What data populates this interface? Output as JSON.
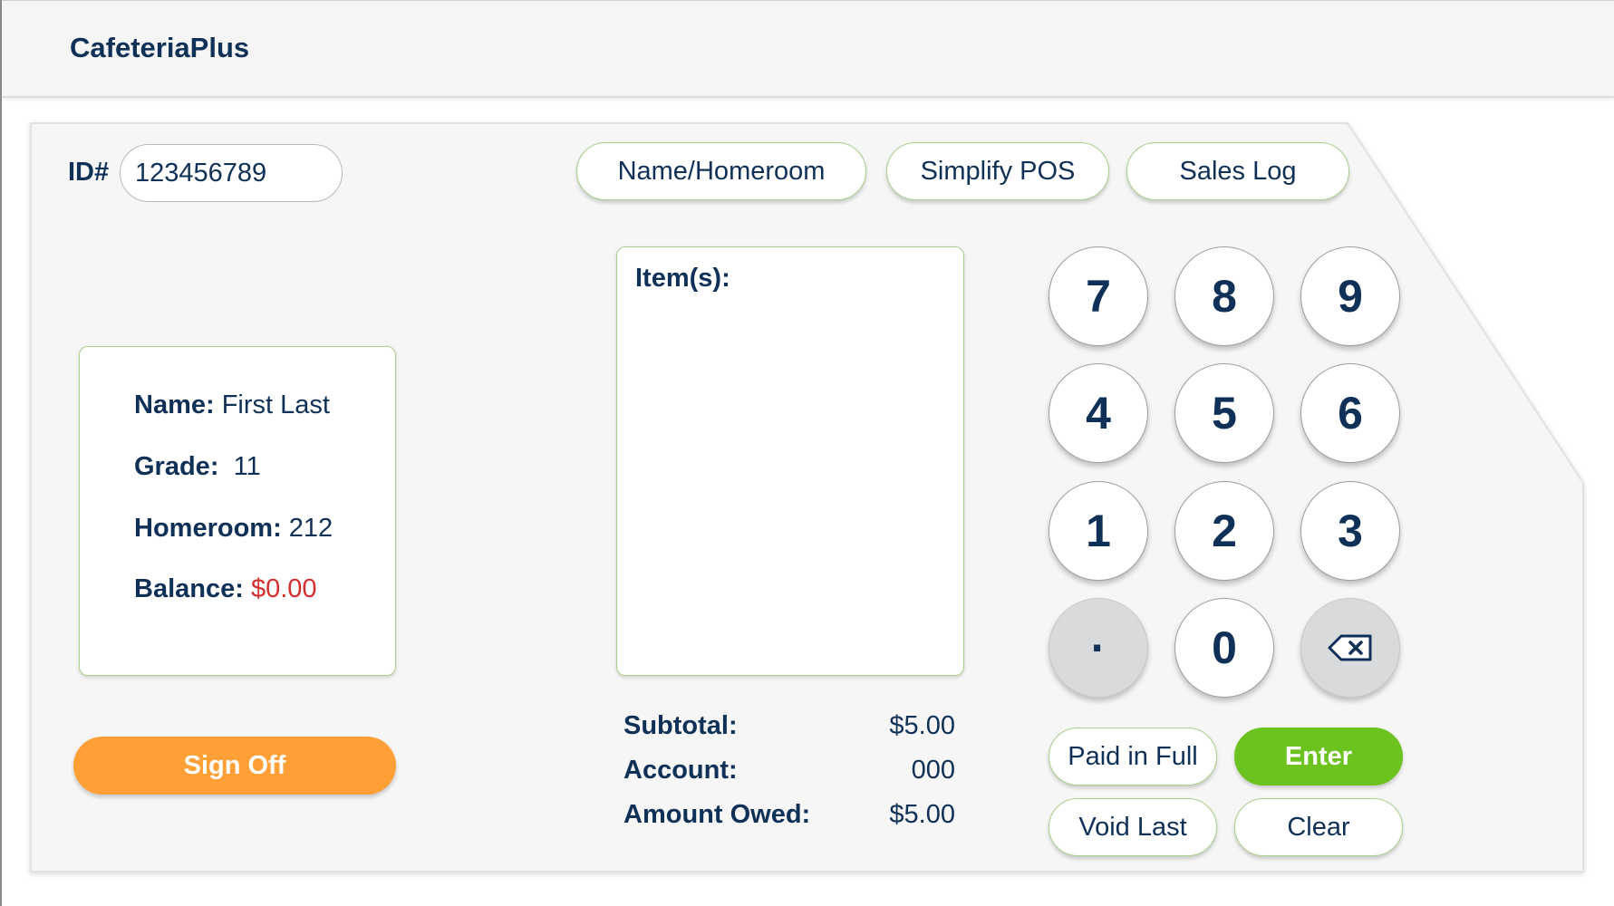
{
  "app": {
    "title": "CafeteriaPlus"
  },
  "id_field": {
    "label": "ID#",
    "value": "123456789"
  },
  "nav": {
    "name_homeroom": "Name/Homeroom",
    "simplify_pos": "Simplify POS",
    "sales_log": "Sales Log"
  },
  "student": {
    "name_label": "Name:",
    "name_value": "First Last",
    "grade_label": "Grade:",
    "grade_value": "11",
    "homeroom_label": "Homeroom:",
    "homeroom_value": "212",
    "balance_label": "Balance:",
    "balance_value": "$0.00"
  },
  "sign_off": "Sign Off",
  "items": {
    "label": "Item(s):"
  },
  "summary": {
    "subtotal_label": "Subtotal:",
    "subtotal_value": "$5.00",
    "account_label": "Account:",
    "account_value": "000",
    "owed_label": "Amount Owed:",
    "owed_value": "$5.00"
  },
  "keypad": {
    "k7": "7",
    "k8": "8",
    "k9": "9",
    "k4": "4",
    "k5": "5",
    "k6": "6",
    "k1": "1",
    "k2": "2",
    "k3": "3",
    "dot": "·",
    "k0": "0"
  },
  "actions": {
    "paid_in_full": "Paid in Full",
    "enter": "Enter",
    "void_last": "Void Last",
    "clear": "Clear"
  },
  "colors": {
    "navy": "#0f3057",
    "accent_green": "#6cc21f",
    "orange": "#ff9f35",
    "red": "#d32f2f",
    "border_green": "#a9d08e"
  }
}
